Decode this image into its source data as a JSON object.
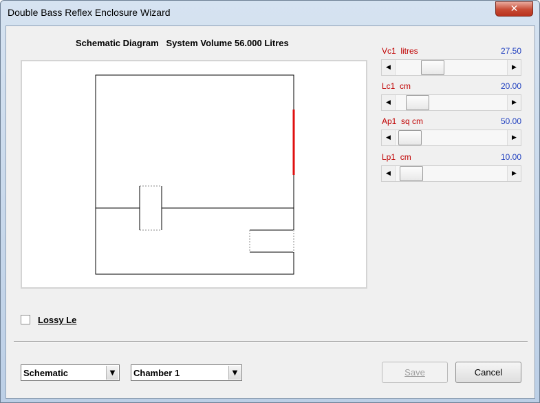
{
  "window": {
    "title": "Double Bass Reflex Enclosure Wizard"
  },
  "diagram": {
    "heading": "Schematic Diagram   System Volume 56.000 Litres"
  },
  "params": [
    {
      "label": "Vc1  litres",
      "value": "27.50",
      "position": 0.29
    },
    {
      "label": "Lc1  cm",
      "value": "20.00",
      "position": 0.12
    },
    {
      "label": "Ap1  sq cm",
      "value": "50.00",
      "position": 0.03
    },
    {
      "label": "Lp1  cm",
      "value": "10.00",
      "position": 0.05
    }
  ],
  "options": {
    "lossy_label": "Lossy Le",
    "lossy_checked": false
  },
  "footer": {
    "view_select": "Schematic",
    "chamber_select": "Chamber 1",
    "save_label": "Save",
    "cancel_label": "Cancel"
  },
  "colors": {
    "label_red": "#c00000",
    "value_blue": "#1f3fbf",
    "driver_red": "#e01010"
  },
  "icons": {
    "close": "close-icon",
    "scroll_left": "chevron-left-icon",
    "scroll_right": "chevron-right-icon",
    "dropdown": "chevron-down-icon"
  }
}
